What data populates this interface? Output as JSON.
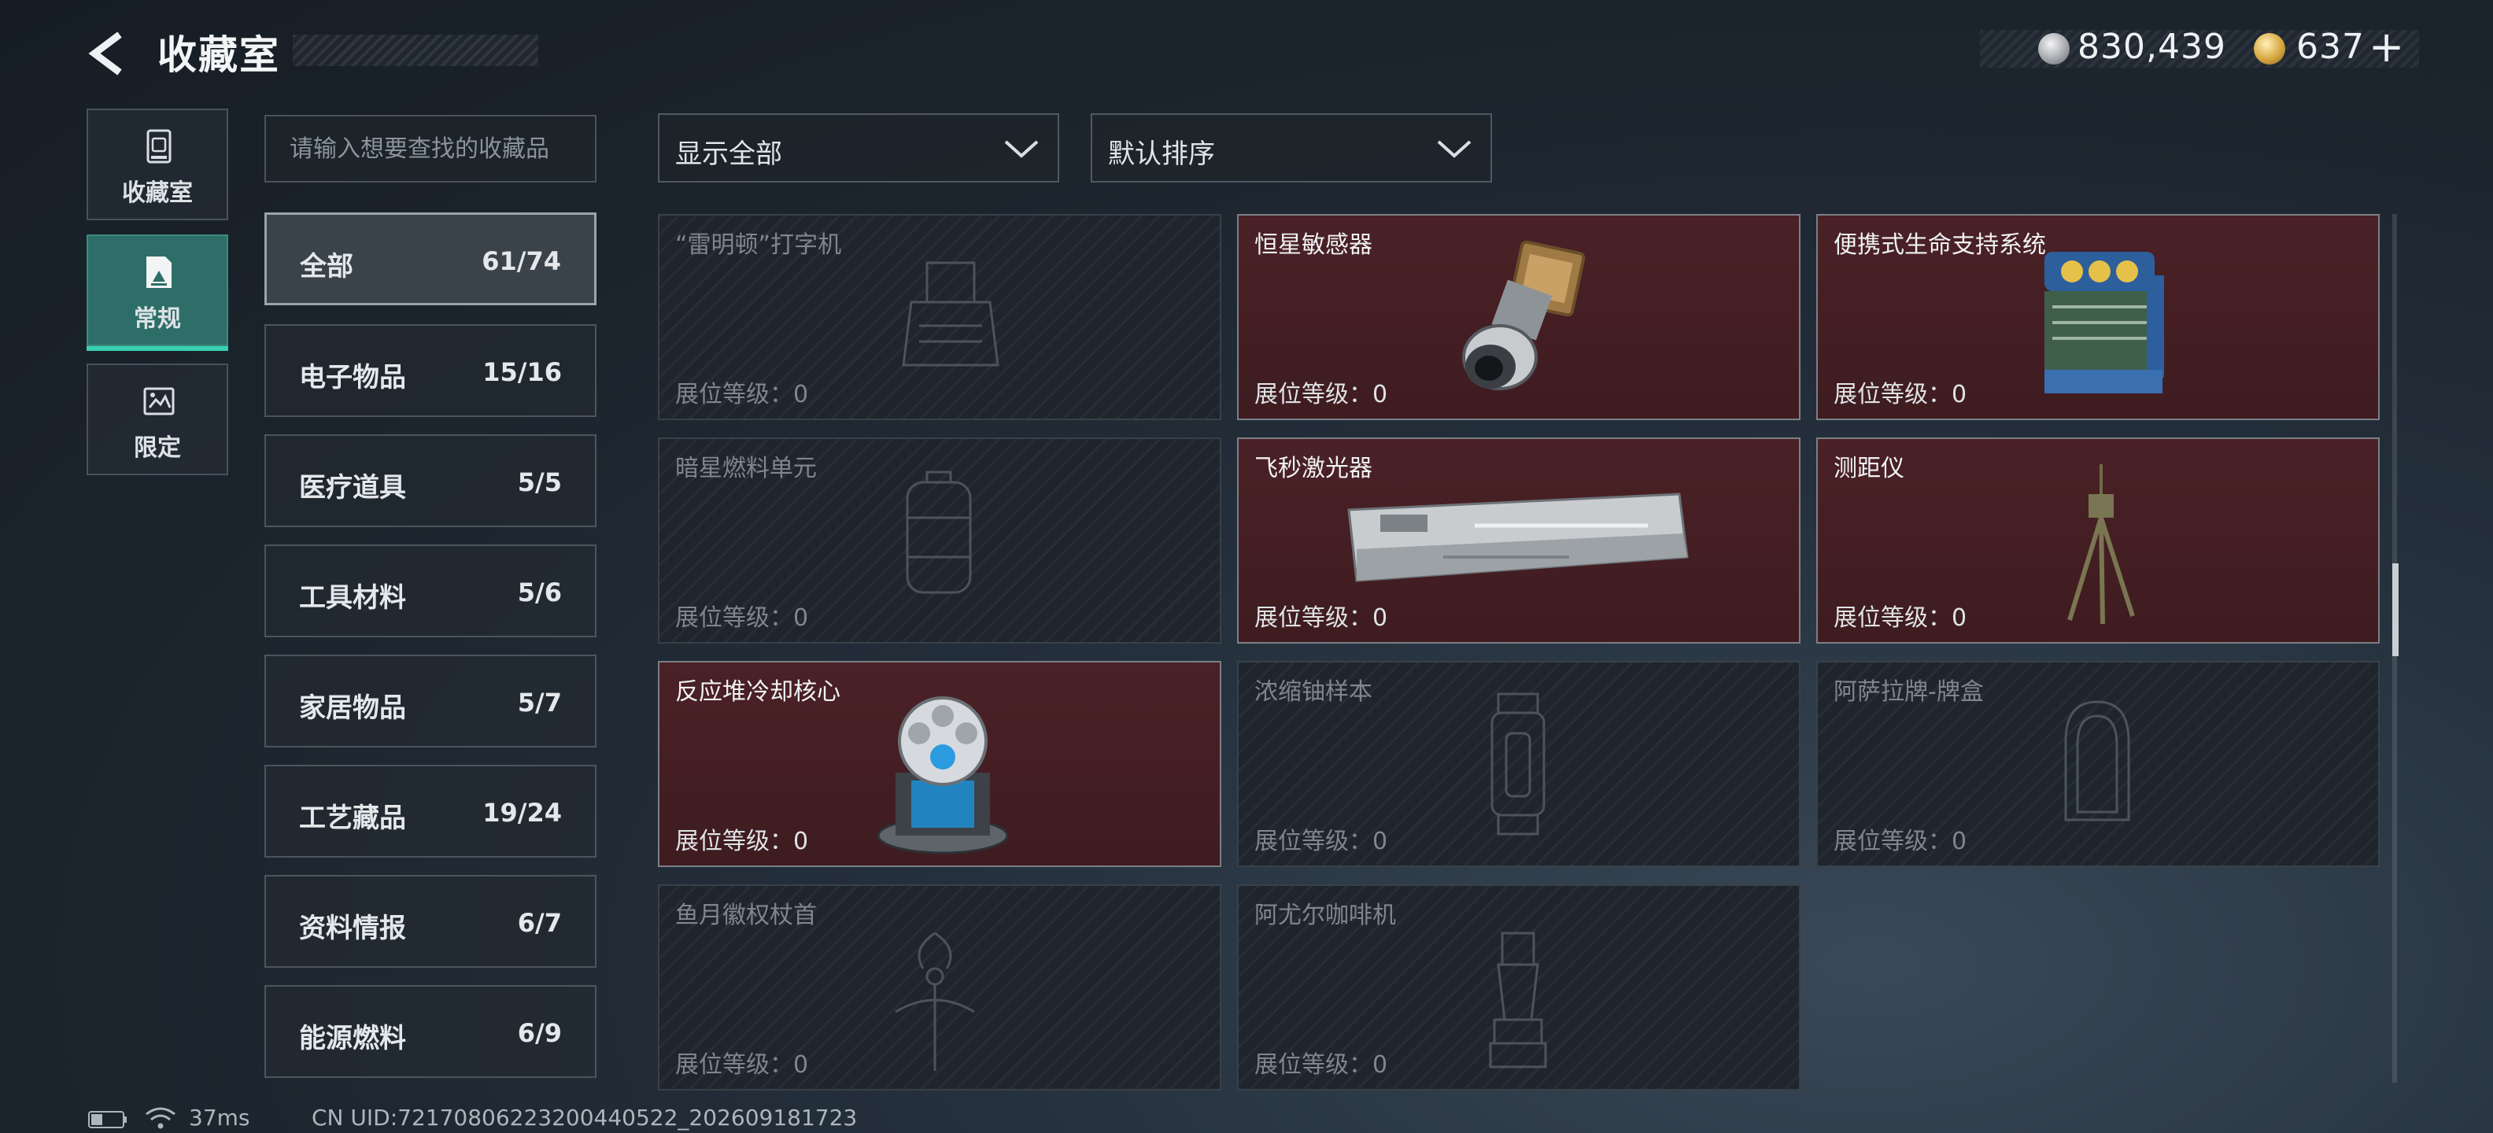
{
  "header": {
    "title": "收藏室"
  },
  "currency": {
    "silver": "830,439",
    "gold": "637",
    "add_label": "+"
  },
  "mode_tabs": [
    {
      "label": "收藏室",
      "icon": "collection-cabinet-icon"
    },
    {
      "label": "常规",
      "icon": "regular-image-icon",
      "selected": true
    },
    {
      "label": "限定",
      "icon": "limited-image-icon"
    }
  ],
  "search": {
    "placeholder": "请输入想要查找的收藏品",
    "value": ""
  },
  "categories": [
    {
      "name": "全部",
      "count": "61/74",
      "selected": true
    },
    {
      "name": "电子物品",
      "count": "15/16"
    },
    {
      "name": "医疗道具",
      "count": "5/5"
    },
    {
      "name": "工具材料",
      "count": "5/6"
    },
    {
      "name": "家居物品",
      "count": "5/7"
    },
    {
      "name": "工艺藏品",
      "count": "19/24"
    },
    {
      "name": "资料情报",
      "count": "6/7"
    },
    {
      "name": "能源燃料",
      "count": "6/9"
    }
  ],
  "filters": {
    "filter_label": "显示全部",
    "sort_label": "默认排序"
  },
  "items": [
    {
      "name": "“雷明顿”打字机",
      "level": "展位等级：0",
      "owned": false,
      "icon": "typewriter-icon"
    },
    {
      "name": "恒星敏感器",
      "level": "展位等级：0",
      "owned": true,
      "icon": "star-sensor-icon"
    },
    {
      "name": "便携式生命支持系统",
      "level": "展位等级：0",
      "owned": true,
      "icon": "life-support-icon"
    },
    {
      "name": "暗星燃料单元",
      "level": "展位等级：0",
      "owned": false,
      "icon": "fuel-cell-icon"
    },
    {
      "name": "飞秒激光器",
      "level": "展位等级：0",
      "owned": true,
      "icon": "laser-icon"
    },
    {
      "name": "测距仪",
      "level": "展位等级：0",
      "owned": true,
      "icon": "rangefinder-icon"
    },
    {
      "name": "反应堆冷却核心",
      "level": "展位等级：0",
      "owned": true,
      "icon": "reactor-core-icon"
    },
    {
      "name": "浓缩铀样本",
      "level": "展位等级：0",
      "owned": false,
      "icon": "uranium-sample-icon"
    },
    {
      "name": "阿萨拉牌-牌盒",
      "level": "展位等级：0",
      "owned": false,
      "icon": "card-box-icon"
    },
    {
      "name": "鱼月徽权杖首",
      "level": "展位等级：0",
      "owned": false,
      "icon": "scepter-head-icon"
    },
    {
      "name": "阿尤尔咖啡机",
      "level": "展位等级：0",
      "owned": false,
      "icon": "coffee-machine-icon"
    }
  ],
  "status_bar": {
    "ping": "37ms",
    "uid": "CN UID:7217080622320044052​2_202609181723"
  },
  "colors": {
    "accent": "#38d1b2",
    "owned_card": "#4a2126",
    "selected_tab": "#2d6f68"
  }
}
